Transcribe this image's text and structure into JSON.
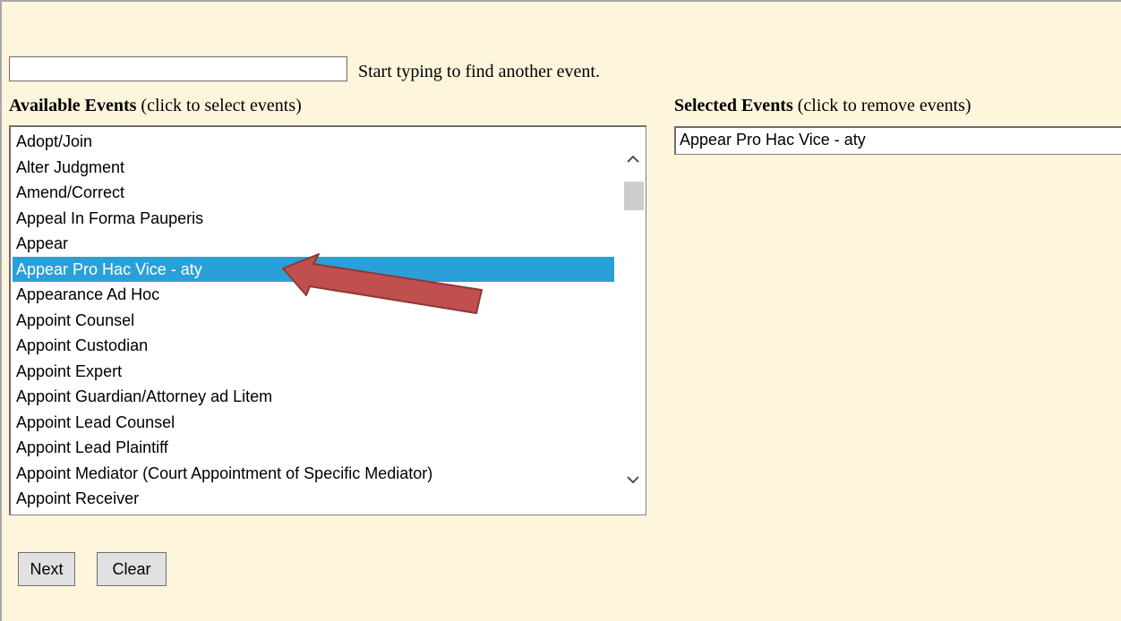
{
  "search": {
    "value": "",
    "hint": "Start typing to find another event."
  },
  "available": {
    "label_bold": "Available Events",
    "label_note": " (click to select events)",
    "items": [
      "Adopt/Join",
      "Alter Judgment",
      "Amend/Correct",
      "Appeal In Forma Pauperis",
      "Appear",
      "Appear Pro Hac Vice - aty",
      "Appearance Ad Hoc",
      "Appoint Counsel",
      "Appoint Custodian",
      "Appoint Expert",
      "Appoint Guardian/Attorney ad Litem",
      "Appoint Lead Counsel",
      "Appoint Lead Plaintiff",
      "Appoint Mediator (Court Appointment of Specific Mediator)",
      "Appoint Receiver"
    ],
    "selected_item": "Appear Pro Hac Vice - aty"
  },
  "selected": {
    "label_bold": "Selected Events",
    "label_note": " (click to remove events)",
    "items": [
      "Appear Pro Hac Vice - aty"
    ]
  },
  "buttons": {
    "next": "Next",
    "clear": "Clear"
  },
  "icons": {
    "scroll_up": "chevron-up-icon",
    "scroll_down": "chevron-down-icon",
    "annotation": "red-arrow-icon"
  },
  "colors": {
    "background": "#fdf5dc",
    "selection": "#2aa0d8",
    "arrow_fill": "#c0504d",
    "arrow_stroke": "#8c3836"
  }
}
